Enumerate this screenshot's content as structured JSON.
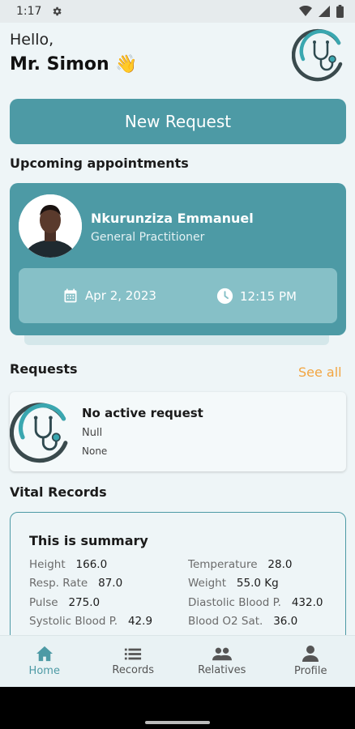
{
  "status": {
    "time": "1:17"
  },
  "header": {
    "greeting": "Hello,",
    "user_name": "Mr. Simon 👋"
  },
  "actions": {
    "new_request_label": "New Request"
  },
  "appointments": {
    "title": "Upcoming appointments",
    "card": {
      "doctor_name": "Nkurunziza Emmanuel",
      "doctor_role": "General Practitioner",
      "date": "Apr 2, 2023",
      "time": "12:15 PM"
    }
  },
  "requests": {
    "title": "Requests",
    "see_all_label": "See all",
    "card": {
      "title": "No active request",
      "status": "Null",
      "detail": "None"
    }
  },
  "vitals": {
    "section_title": "Vital Records",
    "summary_title": "This is summary",
    "items": [
      {
        "label": "Height",
        "value": "166.0"
      },
      {
        "label": "Temperature",
        "value": "28.0"
      },
      {
        "label": "Resp. Rate",
        "value": "87.0"
      },
      {
        "label": "Weight",
        "value": "55.0 Kg"
      },
      {
        "label": "Pulse",
        "value": "275.0"
      },
      {
        "label": "Diastolic Blood P.",
        "value": "432.0"
      },
      {
        "label": "Systolic Blood P.",
        "value": "42.9"
      },
      {
        "label": "Blood O2 Sat.",
        "value": "36.0"
      }
    ]
  },
  "nav": {
    "items": [
      {
        "label": "Home",
        "icon": "home-icon",
        "active": true
      },
      {
        "label": "Records",
        "icon": "list-icon"
      },
      {
        "label": "Relatives",
        "icon": "people-icon"
      },
      {
        "label": "Profile",
        "icon": "person-icon"
      }
    ]
  },
  "colors": {
    "primary": "#4d9aa5",
    "accent": "#f2a541",
    "background": "#eef5f7"
  }
}
